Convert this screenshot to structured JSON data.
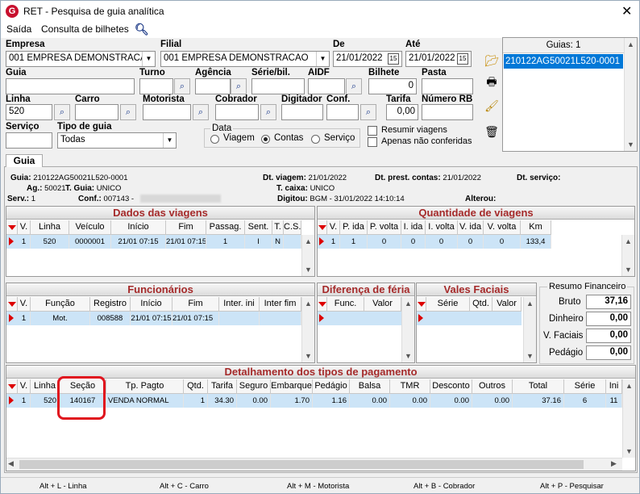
{
  "window": {
    "title": "RET - Pesquisa de guia analítica",
    "app_icon": "G"
  },
  "menu": {
    "items": [
      "Saída",
      "Consulta de bilhetes"
    ]
  },
  "form": {
    "empresa": {
      "label": "Empresa",
      "value": "001 EMPRESA DEMONSTRACAO"
    },
    "filial": {
      "label": "Filial",
      "value": "001 EMPRESA DEMONSTRACAO"
    },
    "de": {
      "label": "De",
      "value": "21/01/2022"
    },
    "ate": {
      "label": "Até",
      "value": "21/01/2022"
    },
    "guia": {
      "label": "Guia",
      "value": ""
    },
    "turno": {
      "label": "Turno",
      "value": ""
    },
    "agencia": {
      "label": "Agência",
      "value": ""
    },
    "serie_bil": {
      "label": "Série/bil.",
      "value": ""
    },
    "aidf": {
      "label": "AIDF",
      "value": ""
    },
    "bilhete": {
      "label": "Bilhete",
      "value": "0"
    },
    "pasta": {
      "label": "Pasta",
      "value": ""
    },
    "linha": {
      "label": "Linha",
      "value": "520"
    },
    "carro": {
      "label": "Carro",
      "value": ""
    },
    "motorista": {
      "label": "Motorista",
      "value": ""
    },
    "cobrador": {
      "label": "Cobrador",
      "value": ""
    },
    "digitador": {
      "label": "Digitador",
      "value": ""
    },
    "conf": {
      "label": "Conf.",
      "value": ""
    },
    "tarifa": {
      "label": "Tarifa",
      "value": "0,00"
    },
    "numero_rb": {
      "label": "Número RB",
      "value": ""
    },
    "servico": {
      "label": "Serviço",
      "value": ""
    },
    "tipo_guia": {
      "label": "Tipo de guia",
      "value": "Todas"
    },
    "data_group": {
      "label": "Data",
      "options": [
        "Viagem",
        "Contas",
        "Serviço"
      ],
      "selected": "Contas"
    },
    "resumir_viagens": {
      "label": "Resumir viagens",
      "checked": false
    },
    "apenas_nao_conferidas": {
      "label": "Apenas não conferidas",
      "checked": false
    }
  },
  "guias_list": {
    "header": "Guias: 1",
    "items": [
      "210122AG50021L520-0001"
    ]
  },
  "tab": {
    "label": "Guia"
  },
  "guia_info": {
    "guia_label": "Guia:",
    "guia_value": "210122AG50021L520-0001",
    "ag_label": "Ag.:",
    "ag_value": "50021",
    "tguia_label": "T. Guia:",
    "tguia_value": "UNICO",
    "serv_label": "Serv.:",
    "serv_value": "1",
    "conf_label": "Conf.:",
    "conf_value": "007143 -",
    "dt_viagem_label": "Dt. viagem:",
    "dt_viagem_value": "21/01/2022",
    "tcaixa_label": "T. caixa:",
    "tcaixa_value": "UNICO",
    "digitou_label": "Digitou:",
    "digitou_value": "BGM - 31/01/2022 14:10:14",
    "dt_prest_label": "Dt. prest. contas:",
    "dt_prest_value": "21/01/2022",
    "alterou_label": "Alterou:",
    "dt_servico_label": "Dt. serviço:"
  },
  "viagens": {
    "title": "Dados das viagens",
    "columns": [
      "V.",
      "Linha",
      "Veículo",
      "Início",
      "Fim",
      "Passag.",
      "Sent.",
      "T.",
      "C.S."
    ],
    "rows": [
      [
        "1",
        "520",
        "0000001",
        "21/01 07:15",
        "21/01 07:15",
        "1",
        "I",
        "N",
        ""
      ]
    ]
  },
  "quantidade": {
    "title": "Quantidade de viagens",
    "columns": [
      "V.",
      "P. ida",
      "P. volta",
      "I. ida",
      "I. volta",
      "V. ida",
      "V. volta",
      "Km"
    ],
    "rows": [
      [
        "1",
        "1",
        "0",
        "0",
        "0",
        "0",
        "0",
        "133,4"
      ]
    ]
  },
  "funcionarios": {
    "title": "Funcionários",
    "columns": [
      "V.",
      "Função",
      "Registro",
      "Início",
      "Fim",
      "Inter. ini",
      "Inter fim"
    ],
    "rows": [
      [
        "1",
        "Mot.",
        "008588",
        "21/01 07:15",
        "21/01 07:15",
        "",
        ""
      ]
    ]
  },
  "diferenca": {
    "title": "Diferença de féria",
    "columns": [
      "Func.",
      "Valor"
    ]
  },
  "vales": {
    "title": "Vales Faciais",
    "columns": [
      "Série",
      "Qtd.",
      "Valor"
    ]
  },
  "resumo": {
    "title": "Resumo Financeiro",
    "items": [
      {
        "label": "Bruto",
        "value": "37,16"
      },
      {
        "label": "Dinheiro",
        "value": "0,00"
      },
      {
        "label": "V. Faciais",
        "value": "0,00"
      },
      {
        "label": "Pedágio",
        "value": "0,00"
      }
    ]
  },
  "detalhamento": {
    "title": "Detalhamento dos tipos de pagamento",
    "columns": [
      "V.",
      "Linha",
      "Seção",
      "Tp. Pagto",
      "Qtd.",
      "Tarifa",
      "Seguro",
      "Embarque",
      "Pedágio",
      "Balsa",
      "TMR",
      "Desconto",
      "Outros",
      "Total",
      "Série",
      "Ini"
    ],
    "rows": [
      [
        "1",
        "520",
        "140167",
        "VENDA NORMAL",
        "1",
        "34.30",
        "0.00",
        "1.70",
        "1.16",
        "0.00",
        "0.00",
        "0.00",
        "0.00",
        "37.16",
        "6",
        "11"
      ]
    ]
  },
  "status_bar": [
    "Alt + L - Linha",
    "Alt + C - Carro",
    "Alt + M - Motorista",
    "Alt + B - Cobrador",
    "Alt + P - Pesquisar"
  ],
  "colors": {
    "section_title": "#a52a2a",
    "selection": "#cce4f7",
    "highlight": "#e0141e",
    "list_selected": "#0078d7"
  }
}
